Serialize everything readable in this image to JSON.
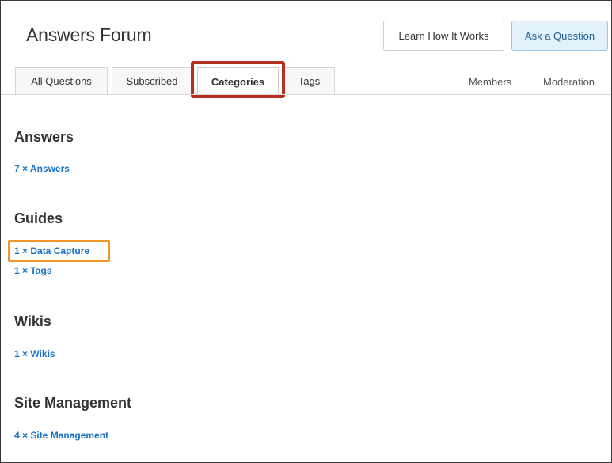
{
  "header": {
    "title": "Answers Forum",
    "learn_button": "Learn How It Works",
    "ask_button": "Ask a Question"
  },
  "tabs": [
    {
      "label": "All Questions",
      "active": false
    },
    {
      "label": "Subscribed",
      "active": false
    },
    {
      "label": "Categories",
      "active": true
    },
    {
      "label": "Tags",
      "active": false
    }
  ],
  "nav": {
    "members": "Members",
    "moderation": "Moderation"
  },
  "sections": [
    {
      "title": "Answers",
      "links": [
        "7 × Answers"
      ]
    },
    {
      "title": "Guides",
      "links": [
        "1 × Data Capture",
        "1 × Tags"
      ]
    },
    {
      "title": "Wikis",
      "links": [
        "1 × Wikis"
      ]
    },
    {
      "title": "Site Management",
      "links": [
        "4 × Site Management"
      ]
    }
  ],
  "colors": {
    "link": "#1a73c7",
    "highlight_red": "#b5301e",
    "highlight_orange": "#f0962a"
  }
}
